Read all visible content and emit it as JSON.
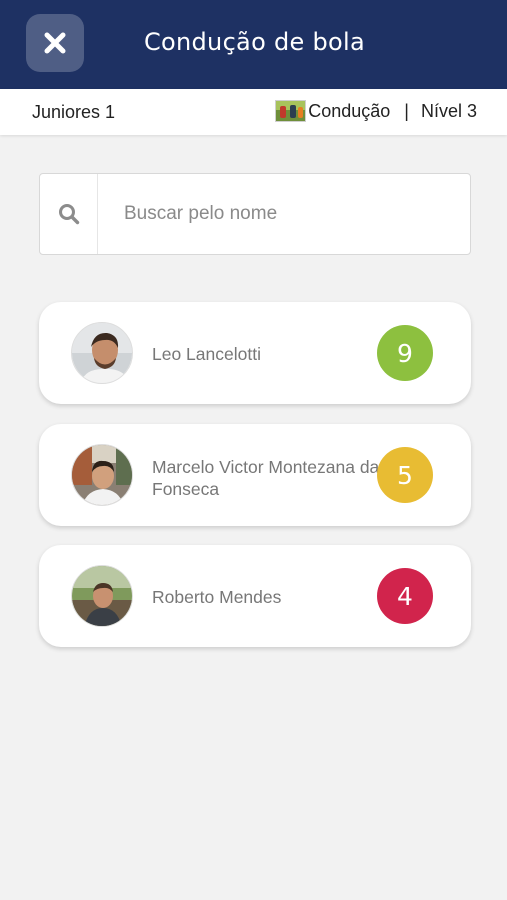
{
  "header": {
    "title": "Condução de bola",
    "close_icon": "close-x-icon",
    "background_color": "#1e3163"
  },
  "subbar": {
    "team": "Juniores 1",
    "exercise": "Condução",
    "separator": "|",
    "level": "Nível 3"
  },
  "search": {
    "placeholder": "Buscar pelo nome",
    "icon": "search-icon"
  },
  "players": [
    {
      "name": "Leo Lancelotti",
      "score": "9",
      "score_color": "#8dc03f"
    },
    {
      "name_line1": "Marcelo Victor Montezana da",
      "name_line2": "Fonseca",
      "score": "5",
      "score_color": "#e8bc33"
    },
    {
      "name": "Roberto  Mendes",
      "score": "4",
      "score_color": "#d1244c"
    }
  ]
}
